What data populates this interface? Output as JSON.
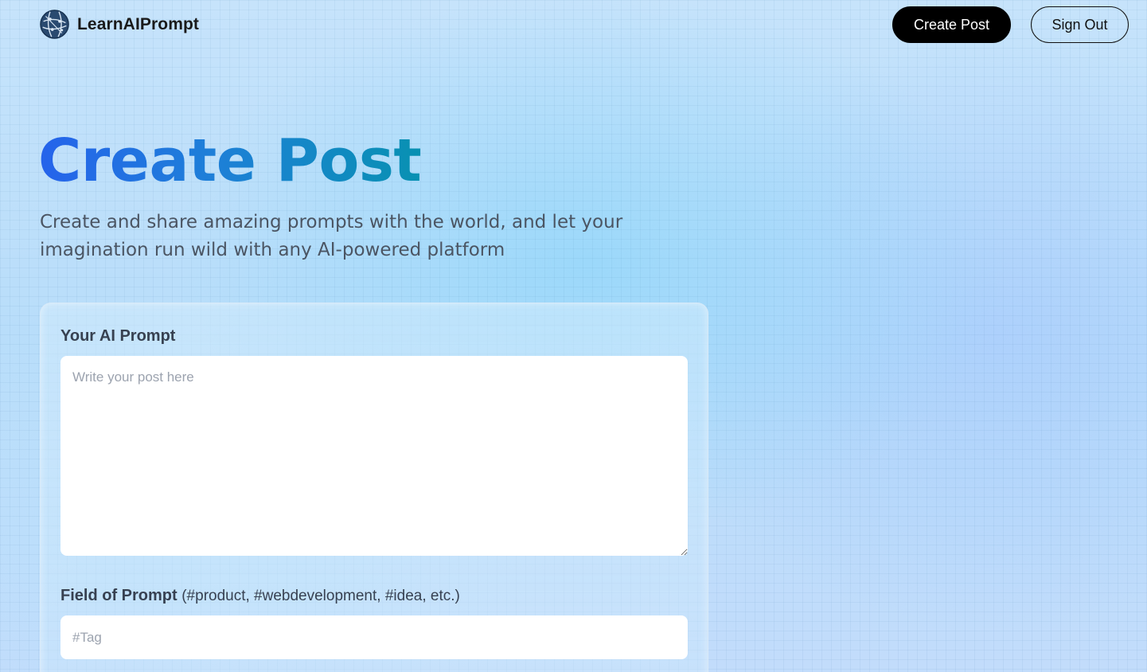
{
  "nav": {
    "brand_name": "LearnAIPrompt",
    "logo_icon": "globe-network-icon",
    "create_post_label": "Create Post",
    "sign_out_label": "Sign Out"
  },
  "hero": {
    "title": "Create Post",
    "description": "Create and share amazing prompts with the world, and let your imagination run wild with any AI-powered platform"
  },
  "form": {
    "prompt_label": "Your AI Prompt",
    "prompt_placeholder": "Write your post here",
    "prompt_value": "",
    "tag_label": "Field of Prompt",
    "tag_hint": "(#product, #webdevelopment, #idea, etc.)",
    "tag_placeholder": "#Tag",
    "tag_value": ""
  },
  "colors": {
    "title_gradient_start": "#2563eb",
    "title_gradient_end": "#0891b2",
    "primary_button": "#000000",
    "logo": "#1e3a5f"
  }
}
